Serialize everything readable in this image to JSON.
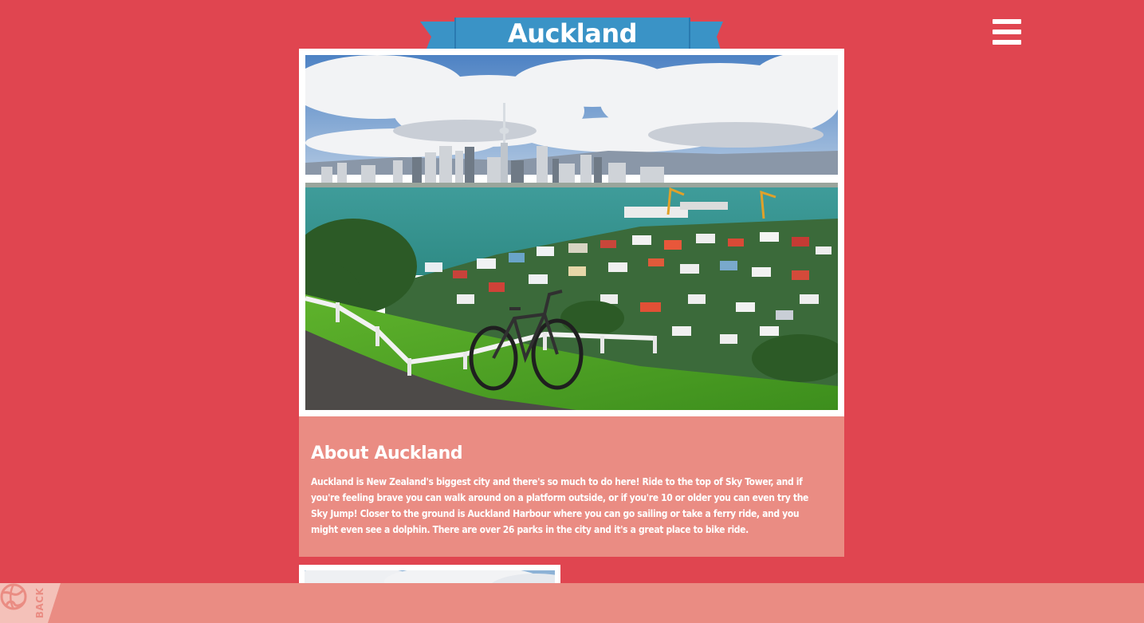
{
  "header": {
    "title": "Auckland",
    "ribbon_color": "#3a93c6",
    "menu_icon": "hamburger-menu-icon"
  },
  "hero": {
    "image_subject": "Auckland skyline with Sky Tower viewed across the harbour, with a bicycle on a grassy hill"
  },
  "about": {
    "heading": "About Auckland",
    "text": "Auckland is New Zealand's biggest city and there's so much to do here! Ride to the top of Sky Tower, and if you're feeling brave you can walk around on a platform outside, or if you're 10 or older you can even try the Sky Jump! Closer to the ground is Auckland Harbour where you can go sailing or take a ferry ride, and you might even see a dolphin. There are over 26 parks in the city and it's a great place to bike ride."
  },
  "footer": {
    "back_label": "BACK",
    "back_icon": "globe-icon"
  },
  "colors": {
    "background": "#e04550",
    "card": "#ea8c83",
    "ribbon": "#3a93c6",
    "ribbon_dark": "#1f6690",
    "text": "#ffffff"
  }
}
